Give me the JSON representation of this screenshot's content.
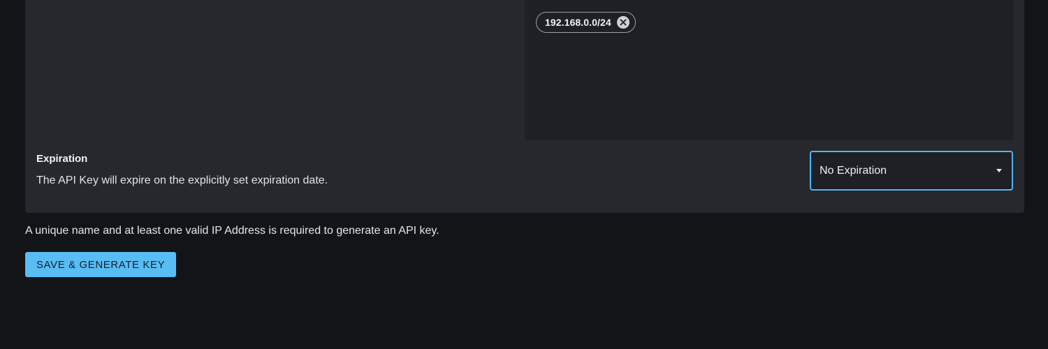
{
  "ip_whitelist": {
    "entries": [
      {
        "label": "192.168.0.0/24",
        "remove_icon": "close-circle-icon"
      }
    ]
  },
  "expiration": {
    "title": "Expiration",
    "description": "The API Key will expire on the explicitly set expiration date.",
    "select": {
      "value": "No Expiration",
      "icon": "caret-down-icon"
    }
  },
  "footer": {
    "note": "A unique name and at least one valid IP Address is required to generate an API key.",
    "save_label": "SAVE & GENERATE KEY"
  },
  "colors": {
    "accent": "#58bdf5",
    "focus_border": "#4cb8f2",
    "card_bg": "#26282e",
    "page_bg": "#131418"
  }
}
